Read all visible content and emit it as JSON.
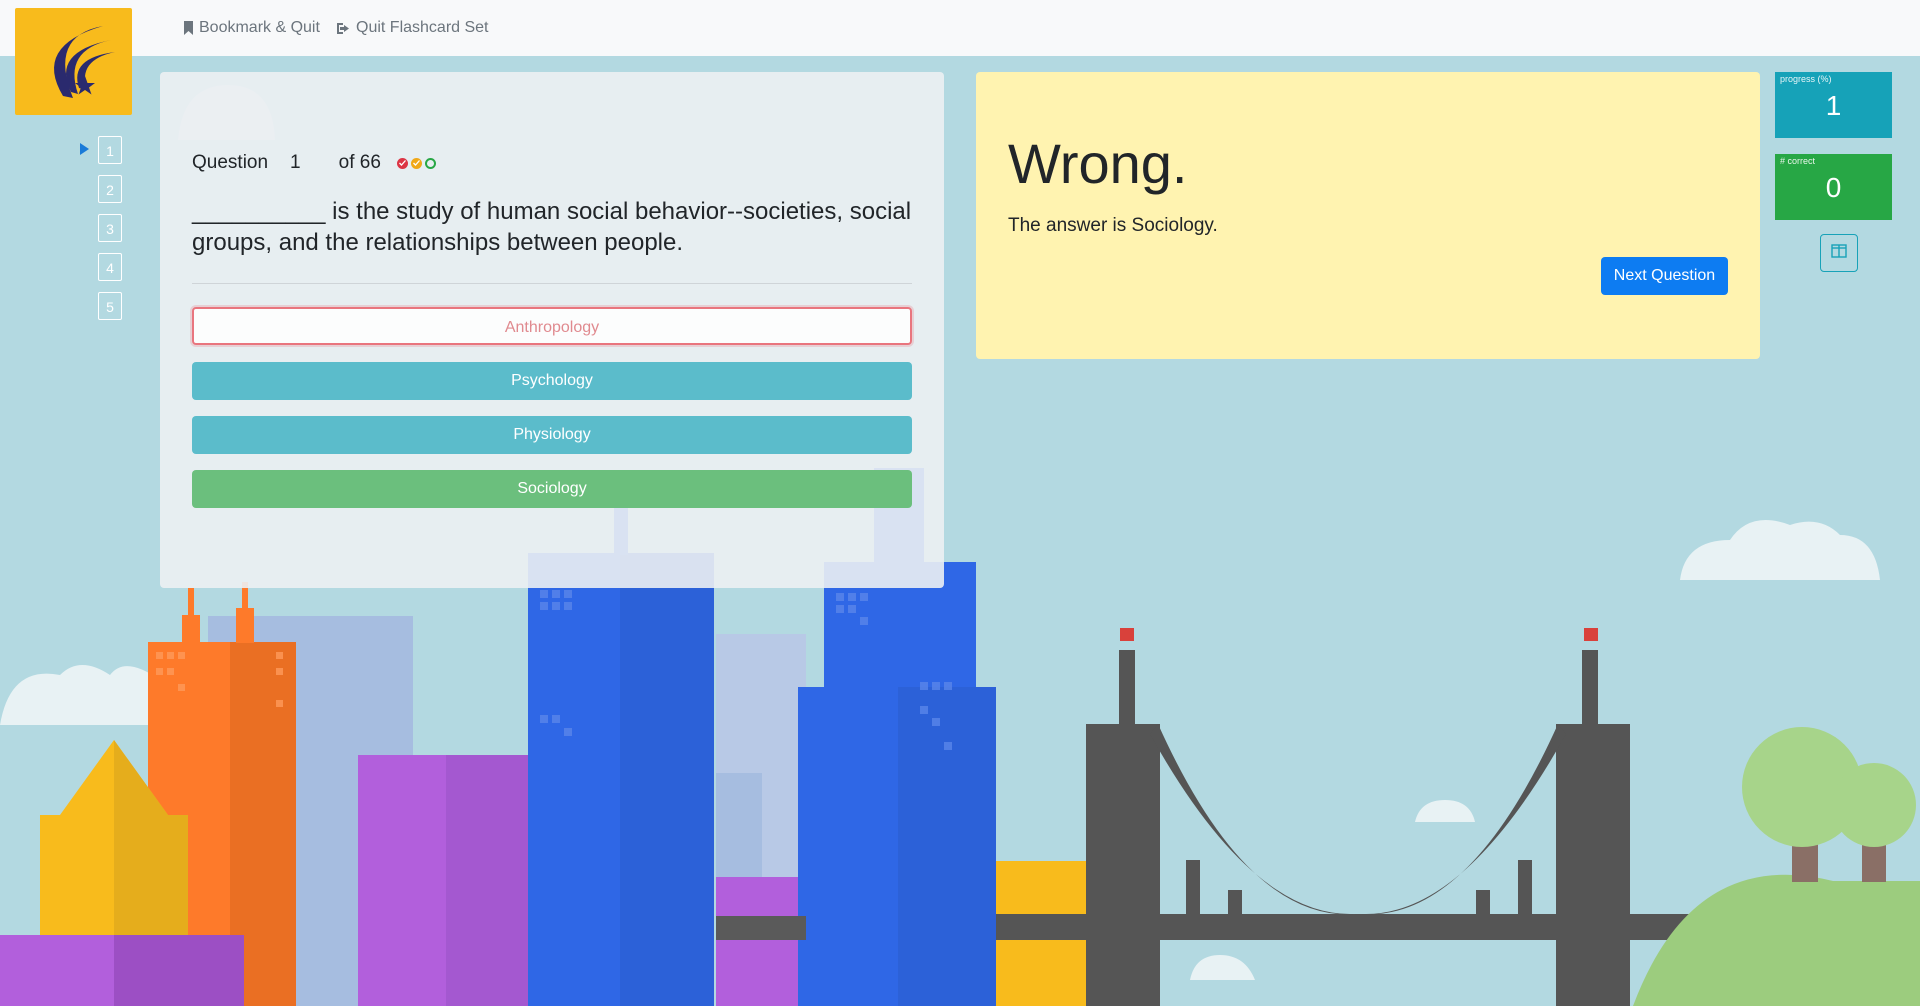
{
  "topbar": {
    "bookmark_label": "Bookmark & Quit",
    "quit_label": "Quit Flashcard Set"
  },
  "question_nav": {
    "items": [
      "1",
      "2",
      "3",
      "4",
      "5"
    ],
    "current": "1"
  },
  "question": {
    "label": "Question",
    "number": "1",
    "of_total": "of 66",
    "text": "__________ is the study of human social behavior--societies, social groups, and the relationships between people.",
    "status_dots": [
      "wrong",
      "partial",
      "pending"
    ]
  },
  "answers": [
    {
      "label": "Anthropology",
      "state": "wrong"
    },
    {
      "label": "Psychology",
      "state": "default"
    },
    {
      "label": "Physiology",
      "state": "default"
    },
    {
      "label": "Sociology",
      "state": "correct"
    }
  ],
  "feedback": {
    "heading": "Wrong.",
    "message": "The answer is Sociology.",
    "next_label": "Next Question"
  },
  "stats": {
    "progress_label": "progress (%)",
    "progress_value": "1",
    "correct_label": "# correct",
    "correct_value": "0"
  },
  "colors": {
    "logo_bg": "#f8bb1c",
    "progress_bg": "#16a2b8",
    "correct_bg": "#27a745",
    "feedback_bg": "#fff3b0",
    "primary": "#0d7cf2"
  }
}
